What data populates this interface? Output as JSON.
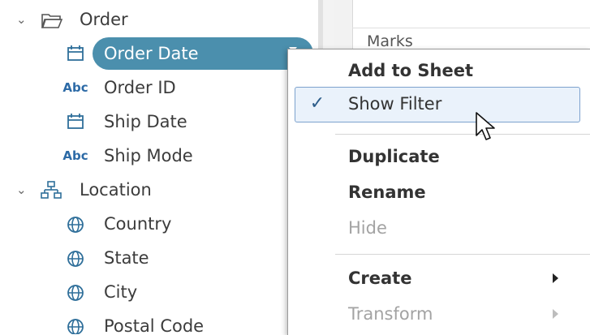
{
  "data_pane": {
    "rows": [
      {
        "type": "folder",
        "label": "Order",
        "icon": "folder-icon",
        "expanded": true
      },
      {
        "type": "field",
        "label": "Order Date",
        "icon": "date-icon",
        "selected": true
      },
      {
        "type": "field",
        "label": "Order ID",
        "icon": "string-icon",
        "abc": "Abc"
      },
      {
        "type": "field",
        "label": "Ship Date",
        "icon": "date-icon"
      },
      {
        "type": "field",
        "label": "Ship Mode",
        "icon": "string-icon",
        "abc": "Abc"
      },
      {
        "type": "folder",
        "label": "Location",
        "icon": "hierarchy-icon",
        "expanded": true
      },
      {
        "type": "field",
        "label": "Country",
        "icon": "globe-icon"
      },
      {
        "type": "field",
        "label": "State",
        "icon": "globe-icon"
      },
      {
        "type": "field",
        "label": "City",
        "icon": "globe-icon"
      },
      {
        "type": "field",
        "label": "Postal Code",
        "icon": "globe-icon"
      }
    ]
  },
  "right_pane": {
    "marks_label": "Marks"
  },
  "context_menu": {
    "items": [
      {
        "label": "Add to Sheet",
        "style": "bold"
      },
      {
        "label": "Show Filter",
        "checked": true,
        "highlighted": true
      },
      {
        "label": "Duplicate",
        "style": "bold"
      },
      {
        "label": "Rename",
        "style": "bold"
      },
      {
        "label": "Hide",
        "disabled": true
      },
      {
        "label": "Create",
        "style": "bold",
        "submenu": true
      },
      {
        "label": "Transform",
        "disabled": true,
        "submenu": true
      }
    ],
    "check_glyph": "✓"
  },
  "colors": {
    "selected_pill": "#4b8fad",
    "highlight_bg": "#eaf2fb",
    "highlight_border": "#7da2ce",
    "string_icon": "#2c6aa6",
    "icon_blue": "#2f6f9a"
  }
}
